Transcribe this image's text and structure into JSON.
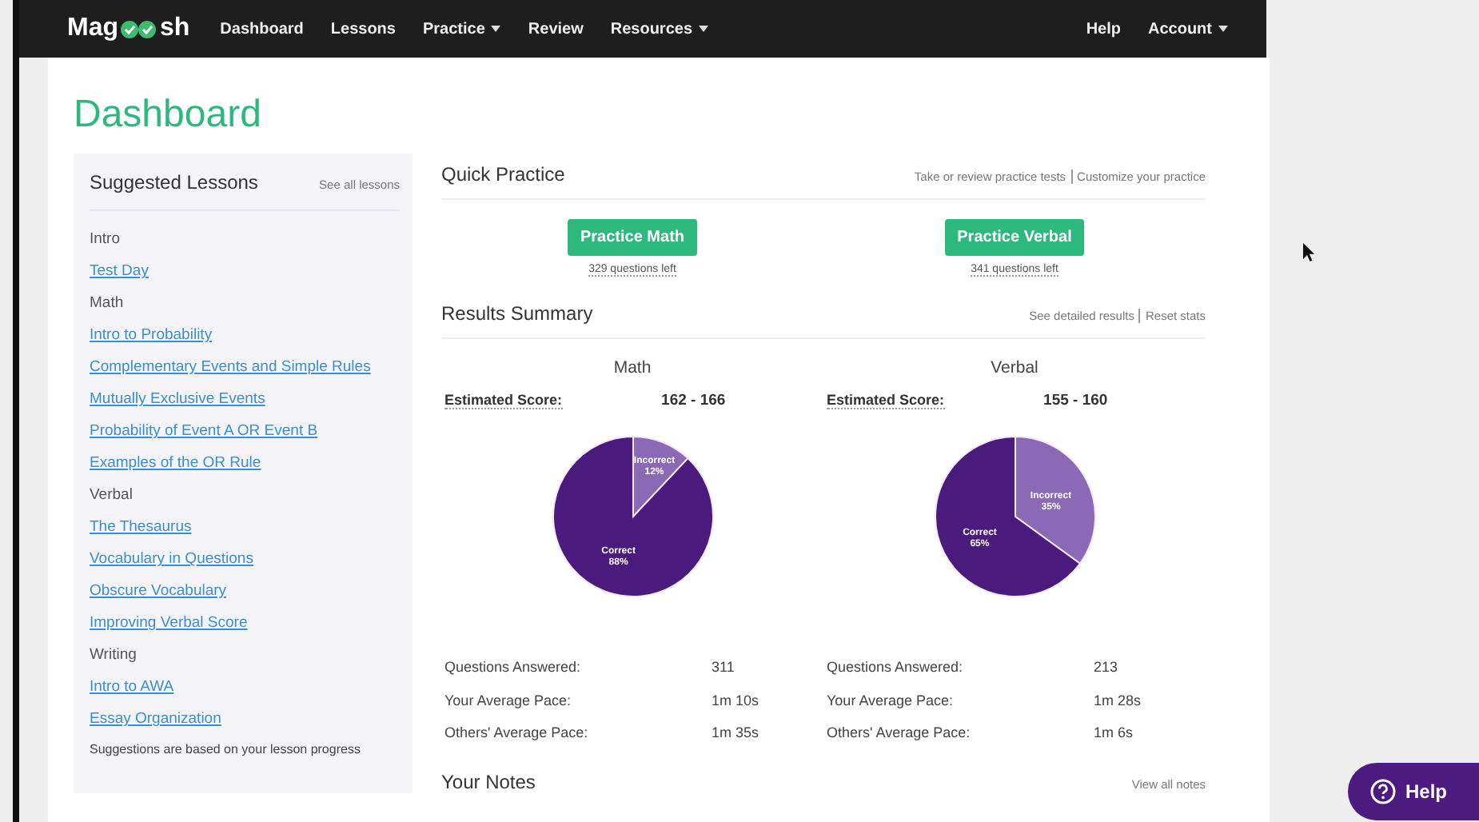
{
  "nav": {
    "logo": [
      "Mag",
      "sh"
    ],
    "items": [
      {
        "label": "Dashboard",
        "dropdown": false
      },
      {
        "label": "Lessons",
        "dropdown": false
      },
      {
        "label": "Practice",
        "dropdown": true
      },
      {
        "label": "Review",
        "dropdown": false
      },
      {
        "label": "Resources",
        "dropdown": true
      }
    ],
    "right_items": [
      {
        "label": "Help",
        "dropdown": false
      },
      {
        "label": "Account",
        "dropdown": true
      }
    ]
  },
  "page_title": "Dashboard",
  "sidebar": {
    "title": "Suggested Lessons",
    "link": "See all lessons",
    "items": [
      {
        "kind": "heading",
        "label": "Intro"
      },
      {
        "kind": "link",
        "label": "Test Day"
      },
      {
        "kind": "heading",
        "label": "Math"
      },
      {
        "kind": "link",
        "label": "Intro to Probability"
      },
      {
        "kind": "link",
        "label": "Complementary Events and Simple Rules"
      },
      {
        "kind": "link",
        "label": "Mutually Exclusive Events"
      },
      {
        "kind": "link",
        "label": "Probability of Event A OR Event B"
      },
      {
        "kind": "link",
        "label": "Examples of the OR Rule"
      },
      {
        "kind": "heading",
        "label": "Verbal"
      },
      {
        "kind": "link",
        "label": "The Thesaurus"
      },
      {
        "kind": "link",
        "label": "Vocabulary in Questions"
      },
      {
        "kind": "link",
        "label": "Obscure Vocabulary"
      },
      {
        "kind": "link",
        "label": "Improving Verbal Score"
      },
      {
        "kind": "heading",
        "label": "Writing"
      },
      {
        "kind": "link",
        "label": "Intro to AWA"
      },
      {
        "kind": "link",
        "label": "Essay Organization"
      }
    ],
    "footer": "Suggestions are based on your lesson progress"
  },
  "quick_practice": {
    "title": "Quick Practice",
    "links": [
      "Take or review practice tests",
      "Customize your practice"
    ],
    "buttons": [
      {
        "label": "Practice Math",
        "note": "329 questions left"
      },
      {
        "label": "Practice Verbal",
        "note": "341 questions left"
      }
    ]
  },
  "results": {
    "title": "Results Summary",
    "links": [
      "See detailed results",
      "Reset stats"
    ],
    "sections": [
      {
        "name": "Math",
        "score_label": "Estimated Score:",
        "score": "162 - 166",
        "chart_data": {
          "type": "pie",
          "categories": [
            "Incorrect",
            "Correct"
          ],
          "values": [
            12,
            88
          ],
          "data_labels": true,
          "value_labels": [
            "12%",
            "88%"
          ]
        },
        "stats": [
          {
            "label": "Questions Answered:",
            "value": "311"
          },
          {
            "label": "Your Average Pace:",
            "value": "1m 10s"
          },
          {
            "label": "Others' Average Pace:",
            "value": "1m 35s"
          }
        ]
      },
      {
        "name": "Verbal",
        "score_label": "Estimated Score:",
        "score": "155 - 160",
        "chart_data": {
          "type": "pie",
          "categories": [
            "Incorrect",
            "Correct"
          ],
          "values": [
            35,
            65
          ],
          "data_labels": true,
          "value_labels": [
            "35%",
            "65%"
          ]
        },
        "stats": [
          {
            "label": "Questions Answered:",
            "value": "213"
          },
          {
            "label": "Your Average Pace:",
            "value": "1m 28s"
          },
          {
            "label": "Others' Average Pace:",
            "value": "1m 6s"
          }
        ]
      }
    ]
  },
  "notes": {
    "title": "Your Notes",
    "link": "View all notes"
  },
  "help_button": {
    "label": "Help"
  }
}
